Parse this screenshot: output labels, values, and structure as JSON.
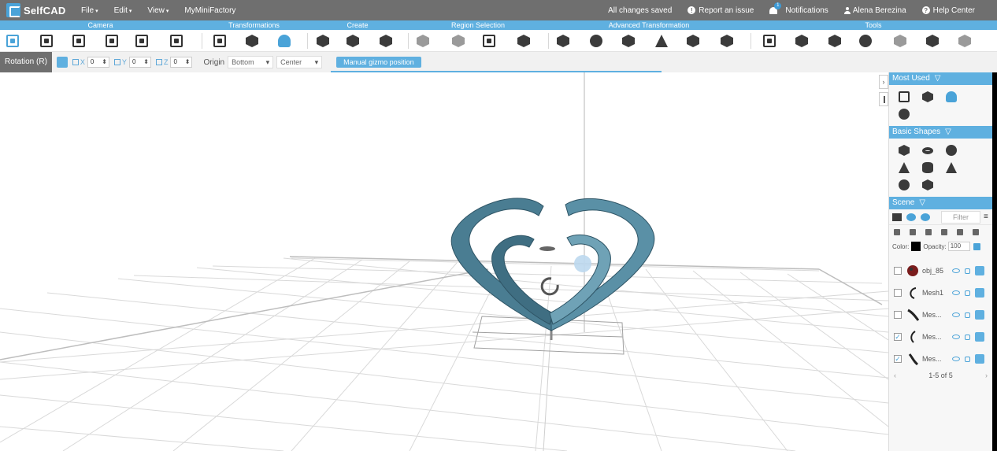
{
  "app": {
    "name": "SelfCAD"
  },
  "menu": [
    {
      "label": "File"
    },
    {
      "label": "Edit"
    },
    {
      "label": "View"
    },
    {
      "label": "MyMiniFactory"
    }
  ],
  "status": {
    "saved": "All changes saved",
    "report": "Report an issue",
    "notifications": "Notifications",
    "notification_count": "1",
    "user": "Alena Berezina",
    "help": "Help Center"
  },
  "sections": [
    "Camera",
    "Transformations",
    "Create",
    "Region Selection",
    "Advanced Transformation",
    "Tools"
  ],
  "options": {
    "mode": "Rotation (R)",
    "x_label": "X",
    "x_value": "0",
    "y_label": "Y",
    "y_value": "0",
    "z_label": "Z",
    "z_value": "0",
    "origin_label": "Origin",
    "origin_value": "Bottom",
    "pivot_value": "Center",
    "manual_button": "Manual gizmo position"
  },
  "panel": {
    "most_used": "Most Used",
    "basic_shapes": "Basic Shapes",
    "scene": "Scene",
    "filter_placeholder": "Filter",
    "color_label": "Color:",
    "opacity_label": "Opacity:",
    "opacity_value": "100",
    "color_value": "#000000",
    "objects": [
      {
        "name": "obj_85",
        "checked": false
      },
      {
        "name": "Mesh1",
        "checked": false
      },
      {
        "name": "Mes...",
        "checked": false
      },
      {
        "name": "Mes...",
        "checked": true
      },
      {
        "name": "Mes...",
        "checked": true
      }
    ],
    "pager": "1-5 of 5"
  },
  "colors": {
    "accent": "#5fb0e0",
    "topbar": "#6f6f6f",
    "model": "#4a7d92"
  }
}
